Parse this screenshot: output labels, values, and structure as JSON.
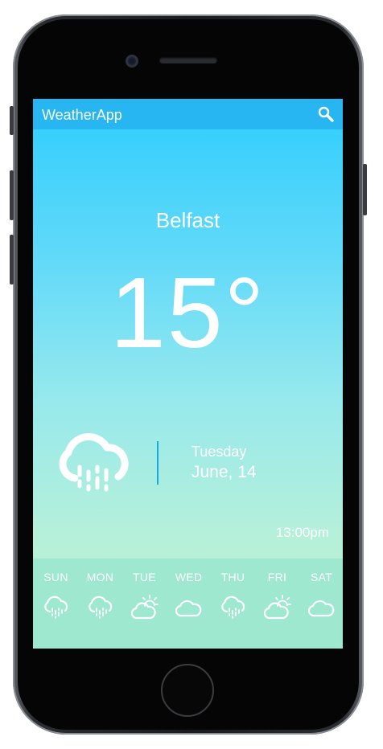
{
  "app": {
    "title": "WeatherApp"
  },
  "current": {
    "city": "Belfast",
    "temperature": "15°",
    "day": "Tuesday",
    "date": "June, 14",
    "time": "13:00pm",
    "condition_icon": "cloud-rain-icon"
  },
  "forecast": [
    {
      "label": "SUN",
      "icon": "cloud-rain-icon"
    },
    {
      "label": "MON",
      "icon": "cloud-rain-icon"
    },
    {
      "label": "TUE",
      "icon": "partly-sunny-icon"
    },
    {
      "label": "WED",
      "icon": "cloud-icon"
    },
    {
      "label": "THU",
      "icon": "cloud-rain-icon"
    },
    {
      "label": "FRI",
      "icon": "partly-sunny-icon"
    },
    {
      "label": "SAT",
      "icon": "cloud-icon"
    }
  ],
  "colors": {
    "app_bar": "#27b6f2",
    "gradient_top": "#2ecdfd",
    "gradient_bottom": "#c3f0cb",
    "forecast_strip": "#9ee8cf",
    "divider": "#1aa9e6"
  }
}
